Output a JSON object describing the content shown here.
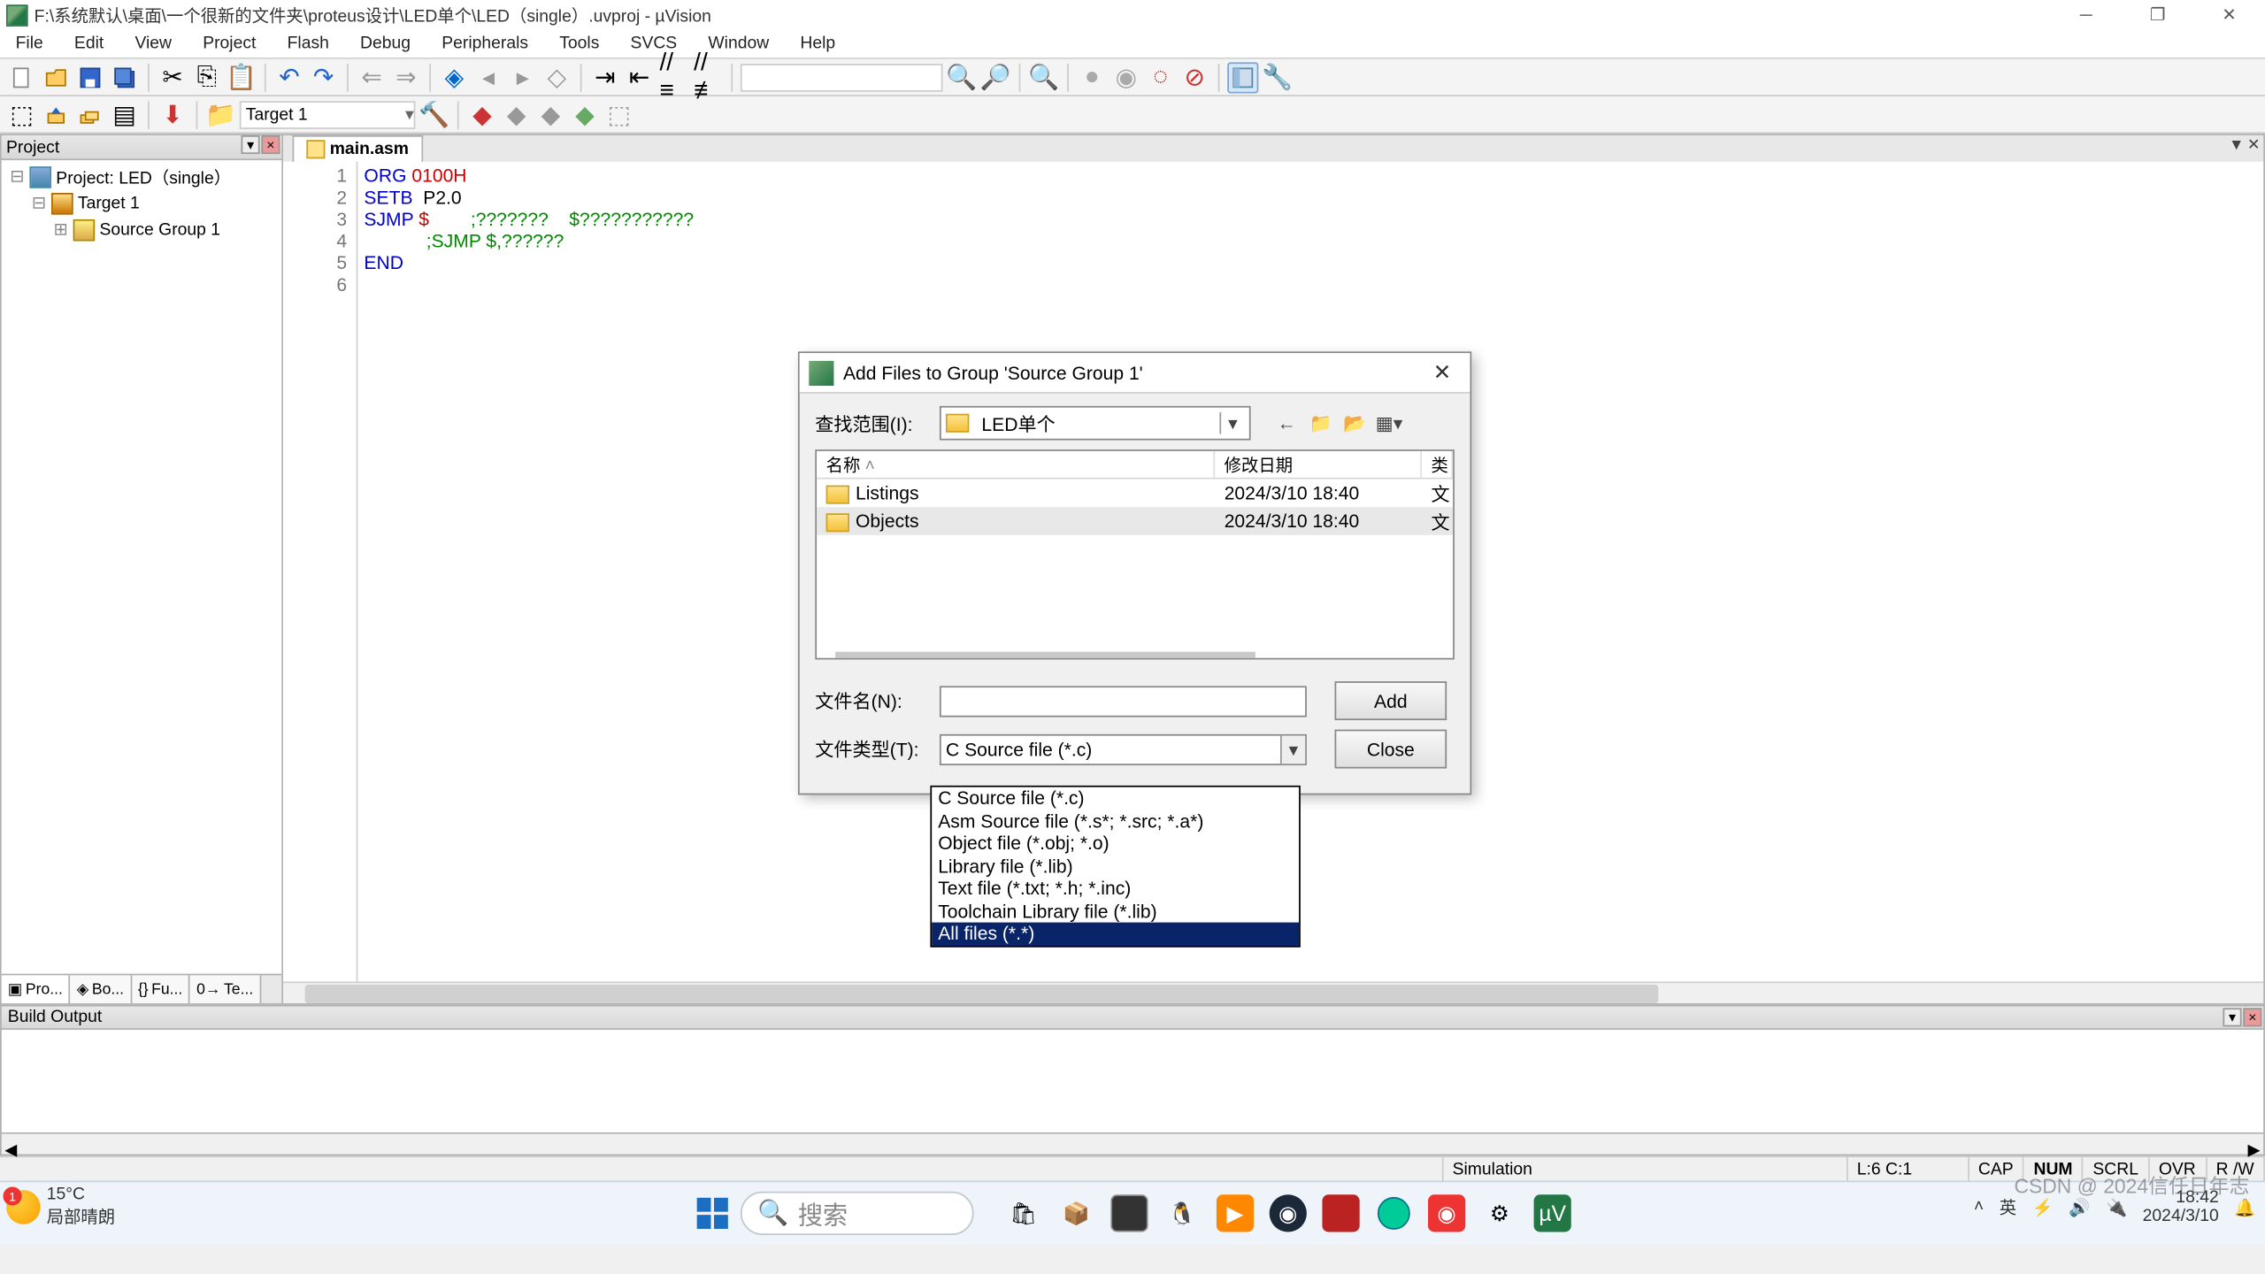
{
  "title": "F:\\系统默认\\桌面\\一个很新的文件夹\\proteus设计\\LED单个\\LED（single）.uvproj - µVision",
  "menus": [
    "File",
    "Edit",
    "View",
    "Project",
    "Flash",
    "Debug",
    "Peripherals",
    "Tools",
    "SVCS",
    "Window",
    "Help"
  ],
  "target_combo": "Target 1",
  "project_pane": {
    "title": "Project",
    "root": "Project: LED（single）",
    "target": "Target 1",
    "group": "Source Group 1"
  },
  "proj_tabs": [
    "Pro...",
    "Bo...",
    "Fu...",
    "Te..."
  ],
  "editor_tab": "main.asm",
  "code": {
    "lines": [
      "ORG 0100H",
      "SETB  P2.0",
      "SJMP $        ;???????    $???????????",
      "            ;SJMP $,??????",
      "END",
      ""
    ],
    "count": 6
  },
  "build_output_title": "Build Output",
  "status": {
    "mode": "Simulation",
    "pos": "L:6 C:1",
    "flags": [
      "CAP",
      "NUM",
      "SCRL",
      "OVR",
      "R /W"
    ]
  },
  "dialog": {
    "title": "Add Files to Group 'Source Group 1'",
    "lookin_label": "查找范围(I):",
    "lookin_value": "LED单个",
    "name_col": "名称",
    "date_col": "修改日期",
    "type_col": "类",
    "rows": [
      {
        "name": "Listings",
        "date": "2024/3/10 18:40",
        "type": "文"
      },
      {
        "name": "Objects",
        "date": "2024/3/10 18:40",
        "type": "文"
      }
    ],
    "filename_label": "文件名(N):",
    "filetype_label": "文件类型(T):",
    "filetype_value": "C Source file (*.c)",
    "add_btn": "Add",
    "close_btn": "Close",
    "dropdown": [
      "C Source file (*.c)",
      "Asm Source file (*.s*; *.src; *.a*)",
      "Object file (*.obj; *.o)",
      "Library file (*.lib)",
      "Text file (*.txt; *.h; *.inc)",
      "Toolchain Library file (*.lib)",
      "All files (*.*)"
    ],
    "dropdown_hl": 6
  },
  "taskbar": {
    "temp": "15°C",
    "weather": "局部晴朗",
    "search_placeholder": "搜索",
    "ime": "英",
    "time": "18:42",
    "date": "2024/3/10"
  },
  "watermark": "CSDN @ 2024信任日年志"
}
